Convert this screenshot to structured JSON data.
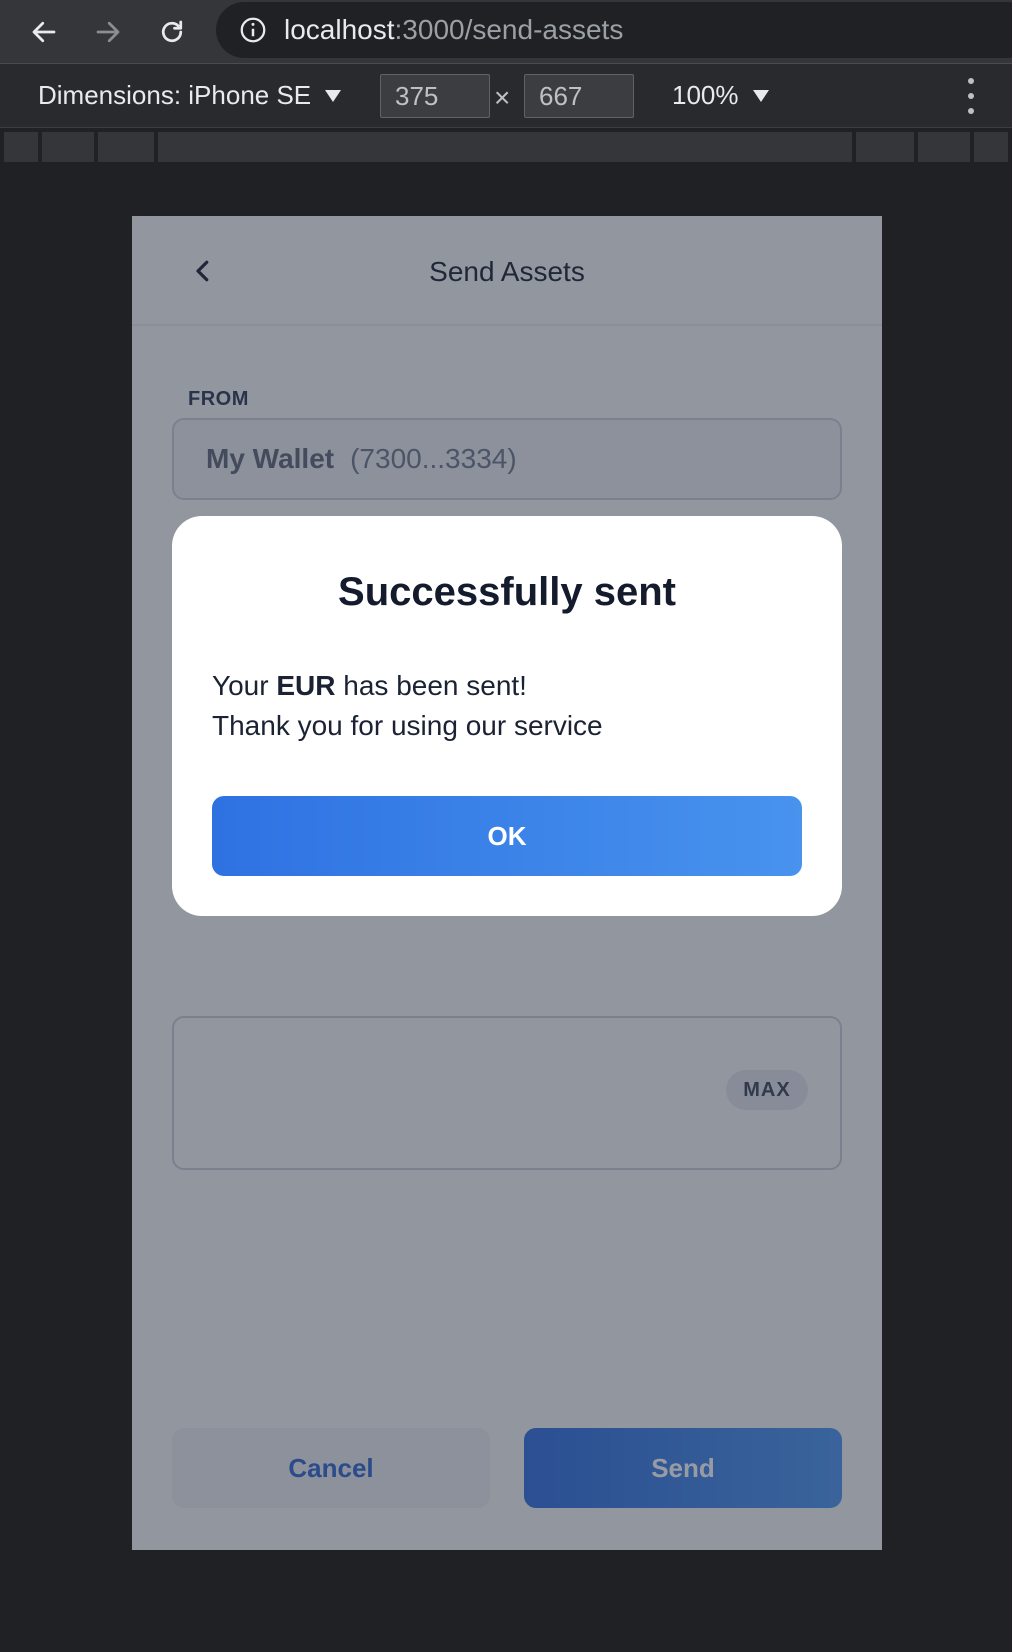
{
  "browser": {
    "url_host": "localhost",
    "url_path": ":3000/send-assets",
    "device_label": "Dimensions: iPhone SE",
    "width": "375",
    "height": "667",
    "times": "×",
    "zoom": "100%"
  },
  "app": {
    "title": "Send Assets",
    "from_label": "FROM",
    "wallet_name": "My Wallet",
    "wallet_address": "(7300...3334)",
    "max_label": "MAX",
    "cancel_label": "Cancel",
    "send_label": "Send"
  },
  "modal": {
    "title": "Successfully sent",
    "line1_prefix": "Your ",
    "line1_currency": "EUR",
    "line1_suffix": " has been sent!",
    "line2": "Thank you for using our service",
    "ok_label": "OK"
  },
  "colors": {
    "primary": "#2f6ee0",
    "primary_light": "#4a95ee",
    "overlay": "#282e3e"
  },
  "icons": {
    "back": "arrow-left-icon",
    "forward": "arrow-right-icon",
    "reload": "reload-icon",
    "info": "info-icon",
    "app_back": "chevron-left-icon",
    "menu": "kebab-menu-icon"
  }
}
